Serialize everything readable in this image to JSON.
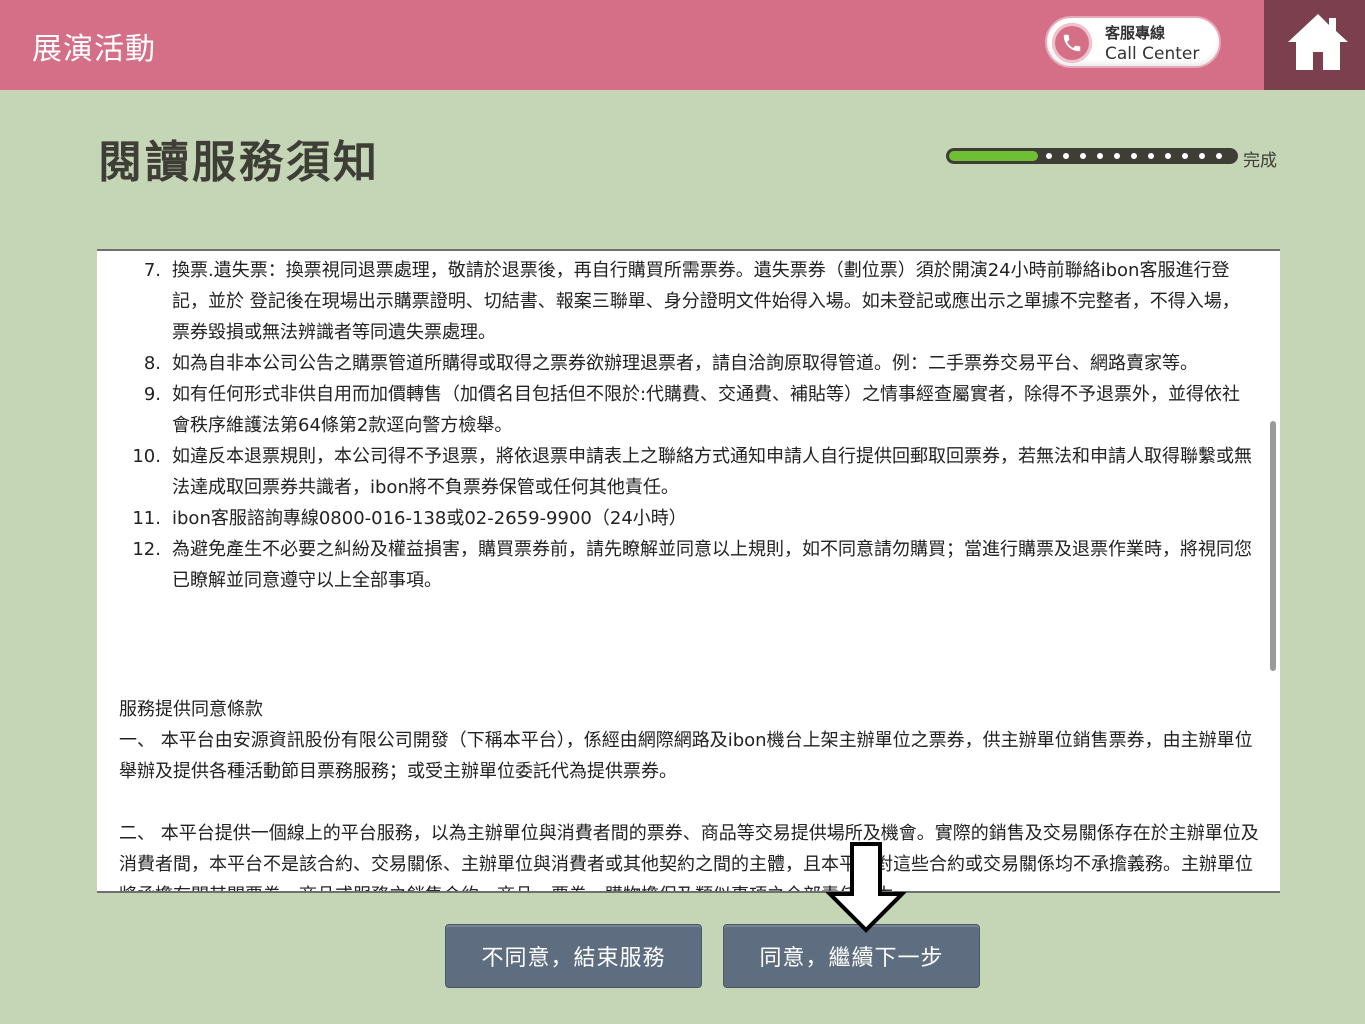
{
  "header": {
    "title": "展演活動",
    "call_center_line1": "客服專線",
    "call_center_line2": "Call Center"
  },
  "page": {
    "title": "閱讀服務須知",
    "progress_label": "完成",
    "progress_fraction": 0.31
  },
  "rules": [
    {
      "num": "7.",
      "text": "換票.遺失票：換票視同退票處理，敬請於退票後，再自行購買所需票券。遺失票券（劃位票）須於開演24小時前聯絡ibon客服進行登記，並於 登記後在現場出示購票證明、切結書、報案三聯單、身分證明文件始得入場。如未登記或應出示之單據不完整者，不得入場，票券毀損或無法辨識者等同遺失票處理。"
    },
    {
      "num": "8.",
      "text": "如為自非本公司公告之購票管道所購得或取得之票券欲辦理退票者，請自洽詢原取得管道。例：二手票券交易平台、網路賣家等。"
    },
    {
      "num": "9.",
      "text": "如有任何形式非供自用而加價轉售（加價名目包括但不限於:代購費、交通費、補貼等）之情事經查屬實者，除得不予退票外，並得依社會秩序維護法第64條第2款逕向警方檢舉。"
    },
    {
      "num": "10.",
      "text": "如違反本退票規則，本公司得不予退票，將依退票申請表上之聯絡方式通知申請人自行提供回郵取回票券，若無法和申請人取得聯繫或無法達成取回票券共識者，ibon將不負票券保管或任何其他責任。"
    },
    {
      "num": "11.",
      "text": "ibon客服諮詢專線0800-016-138或02-2659-9900（24小時）"
    },
    {
      "num": "12.",
      "text": "為避免產生不必要之糾紛及權益損害，購買票券前，請先瞭解並同意以上規則，如不同意請勿購買；當進行購票及退票作業時，將視同您已瞭解並同意遵守以上全部事項。"
    }
  ],
  "terms": {
    "heading": "服務提供同意條款",
    "para1": "一、 本平台由安源資訊股份有限公司開發（下稱本平台），係經由網際網路及ibon機台上架主辦單位之票券，供主辦單位銷售票券，由主辦單位舉辦及提供各種活動節目票務服務；或受主辦單位委託代為提供票券。",
    "para2": "二、 本平台提供一個線上的平台服務，以為主辦單位與消費者間的票券、商品等交易提供場所及機會。實際的銷售及交易關係存在於主辦單位及消費者間，本平台不是該合約、交易關係、主辦單位與消費者或其他契約之間的主體，且本平台對這些合約或交易關係均不承擔義務。主辦單位將承擔有關其間票券、商品或服務之銷售合約、商品、票券、購物擔保及類似事項之全部責任。本"
  },
  "buttons": {
    "disagree": "不同意，結束服務",
    "agree": "同意，繼續下一步"
  },
  "colors": {
    "header_bg": "#d56f88",
    "home_bg": "#7b3f4d",
    "page_bg": "#c4d6b6",
    "button_bg": "#5e6e80",
    "progress_fill": "#6fbf34"
  }
}
